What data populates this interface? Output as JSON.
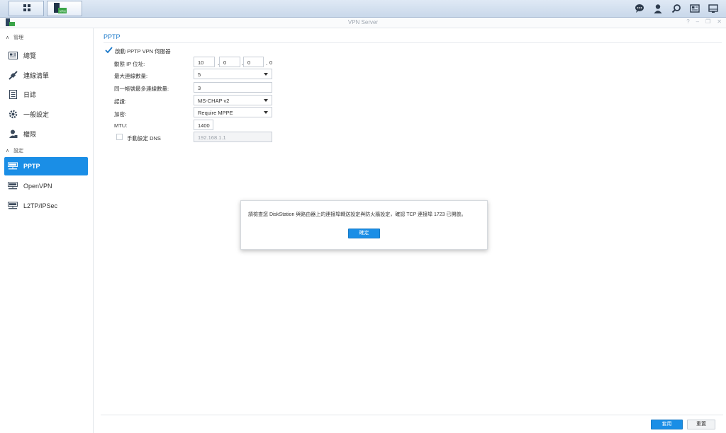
{
  "window": {
    "title": "VPN Server",
    "app_icon": "vpn-server-icon"
  },
  "taskbar": {
    "main_menu_icon": "grid-icon",
    "active_app_icon": "vpn-app-icon",
    "tray_icons": [
      "chat-icon",
      "user-icon",
      "search-icon",
      "widgets-icon",
      "desktop-icon"
    ]
  },
  "sidebar": {
    "sections": [
      {
        "label": "管理",
        "items": [
          {
            "label": "總覽",
            "icon": "overview-icon"
          },
          {
            "label": "連線清單",
            "icon": "connection-list-icon"
          },
          {
            "label": "日誌",
            "icon": "log-icon"
          },
          {
            "label": "一般設定",
            "icon": "gear-icon"
          },
          {
            "label": "權限",
            "icon": "permission-icon"
          }
        ]
      },
      {
        "label": "設定",
        "items": [
          {
            "label": "PPTP",
            "icon": "network-icon",
            "selected": true
          },
          {
            "label": "OpenVPN",
            "icon": "network-icon"
          },
          {
            "label": "L2TP/IPSec",
            "icon": "network-icon"
          }
        ]
      }
    ]
  },
  "pptp": {
    "title": "PPTP",
    "enable_label": "啟動 PPTP VPN 伺服器",
    "enable_checked": true,
    "dynamic_ip": {
      "label": "動態 IP 位址:",
      "octets": [
        "10",
        "0",
        "0",
        "0"
      ]
    },
    "max_connections": {
      "label": "最大連線數量:",
      "value": "5"
    },
    "max_same_account": {
      "label": "同一帳號最多連線數量:",
      "value": "3"
    },
    "auth": {
      "label": "認證:",
      "value": "MS-CHAP v2"
    },
    "encryption": {
      "label": "加密:",
      "value": "Require MPPE"
    },
    "mtu": {
      "label": "MTU:",
      "value": "1400"
    },
    "manual_dns": {
      "label": "手動設定 DNS",
      "checked": false,
      "value": "192.168.1.1"
    }
  },
  "footer": {
    "apply_label": "套用",
    "reset_label": "重置"
  },
  "dialog": {
    "message": "請檢查您 DiskStation 與路由器上的連接埠轉送設定與防火牆設定，確認 TCP 連接埠 1723 已開啟。",
    "ok_label": "確定"
  },
  "colors": {
    "accent": "#1a8ee6",
    "title_blue": "#1a78c9"
  }
}
